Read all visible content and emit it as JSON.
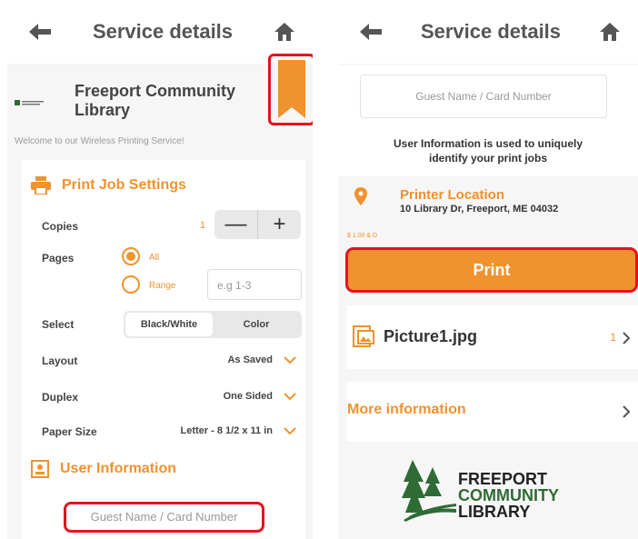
{
  "left_panel": {
    "title": "Service details",
    "library_name": "Freeport Community Library",
    "welcome": "Welcome to our Wireless Printing Service!",
    "print_job_settings": {
      "heading": "Print Job Settings",
      "copies_label": "Copies",
      "copies_value": "1",
      "decrement": "—",
      "increment": "+",
      "pages_label": "Pages",
      "pages_all": "All",
      "pages_range": "Range",
      "range_placeholder": "e.g 1-3",
      "select_label": "Select",
      "select_options": [
        "Black/White",
        "Color"
      ],
      "layout_label": "Layout",
      "layout_value": "As Saved",
      "duplex_label": "Duplex",
      "duplex_value": "One Sided",
      "paper_size_label": "Paper Size",
      "paper_size_value": "Letter - 8 1/2 x 11 in"
    },
    "user_information": {
      "heading": "User Information",
      "guest_placeholder": "Guest Name / Card Number"
    }
  },
  "right_panel": {
    "title": "Service details",
    "guest_placeholder": "Guest Name / Card Number",
    "user_info_note_line1": "User Information is used to uniquely",
    "user_info_note_line2": "identify your print jobs",
    "printer_location_title": "Printer Location",
    "printer_location_address": "10 Library Dr, Freeport, ME 04032",
    "tiny_tag": "$ 1.00 & D",
    "print_button": "Print",
    "file_name": "Picture1.jpg",
    "file_count": "1",
    "more_information": "More information",
    "brand_line1": "FREEPORT",
    "brand_line2": "COMMUNITY",
    "brand_line3": "LIBRARY"
  },
  "colors": {
    "accent": "#f0922e",
    "highlight": "#e2141e",
    "brand_green": "#2f6b34"
  }
}
